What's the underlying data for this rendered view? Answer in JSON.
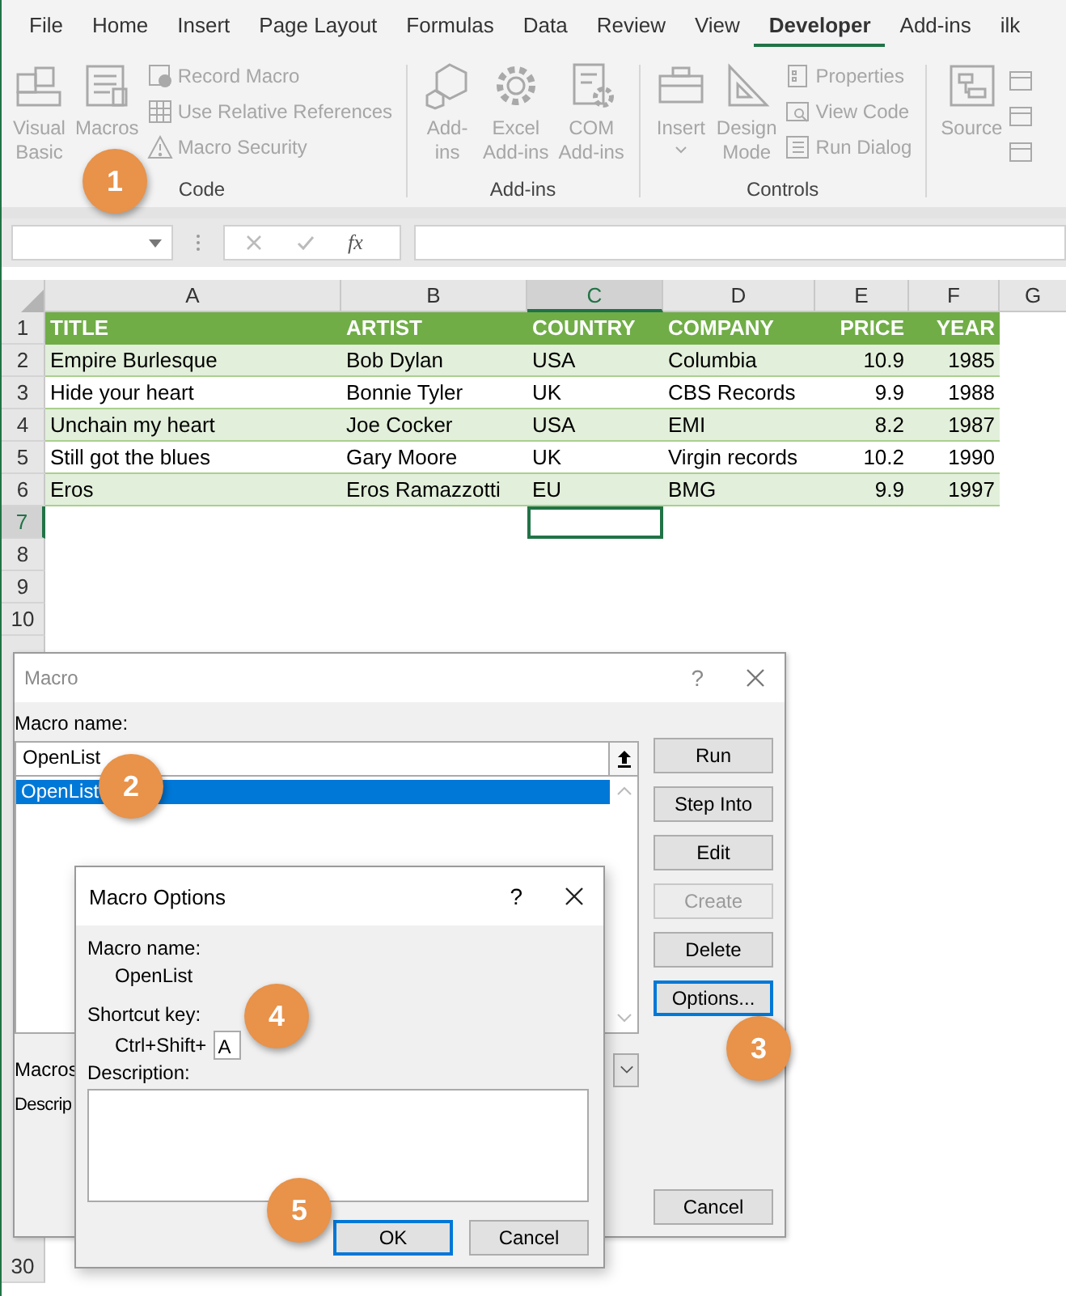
{
  "ribbon": {
    "tabs": [
      {
        "label": "File",
        "selected": false
      },
      {
        "label": "Home",
        "selected": false
      },
      {
        "label": "Insert",
        "selected": false
      },
      {
        "label": "Page Layout",
        "selected": false
      },
      {
        "label": "Formulas",
        "selected": false
      },
      {
        "label": "Data",
        "selected": false
      },
      {
        "label": "Review",
        "selected": false
      },
      {
        "label": "View",
        "selected": false
      },
      {
        "label": "Developer",
        "selected": true
      },
      {
        "label": "Add-ins",
        "selected": false
      },
      {
        "label": "ilk",
        "selected": false
      }
    ],
    "groups": [
      {
        "label": "Code",
        "large": [
          {
            "lines": [
              "Visual",
              "Basic"
            ],
            "dropdown": false
          },
          {
            "lines": [
              "Macros"
            ],
            "dropdown": false
          }
        ],
        "small": [
          "Record Macro",
          "Use Relative References",
          "Macro Security"
        ]
      },
      {
        "label": "Add-ins",
        "large": [
          {
            "lines": [
              "Add-",
              "ins"
            ],
            "dropdown": false
          },
          {
            "lines": [
              "Excel",
              "Add-ins"
            ],
            "dropdown": false
          },
          {
            "lines": [
              "COM",
              "Add-ins"
            ],
            "dropdown": false
          }
        ]
      },
      {
        "label": "Controls",
        "large": [
          {
            "lines": [
              "Insert"
            ],
            "dropdown": true
          },
          {
            "lines": [
              "Design",
              "Mode"
            ],
            "dropdown": false
          }
        ],
        "small": [
          "Properties",
          "View Code",
          "Run Dialog"
        ]
      },
      {
        "large": [
          {
            "lines": [
              "Source"
            ],
            "dropdown": false
          }
        ]
      }
    ]
  },
  "formula_bar": {
    "function_label": "fx"
  },
  "sheet": {
    "columns": [
      {
        "letter": "A",
        "selected": false,
        "kind": "text"
      },
      {
        "letter": "B",
        "selected": false,
        "kind": "text"
      },
      {
        "letter": "C",
        "selected": true,
        "kind": "text"
      },
      {
        "letter": "D",
        "selected": false,
        "kind": "text"
      },
      {
        "letter": "E",
        "selected": false,
        "kind": "number"
      },
      {
        "letter": "F",
        "selected": false,
        "kind": "number"
      },
      {
        "letter": "G",
        "selected": false
      }
    ],
    "rows": [
      {
        "number": "1",
        "selected": false,
        "kind": "header",
        "cells": [
          {
            "text": "TITLE",
            "selected": false
          },
          {
            "text": "ARTIST",
            "selected": false
          },
          {
            "text": "COUNTRY",
            "selected": false
          },
          {
            "text": "COMPANY",
            "selected": false
          },
          {
            "text": "PRICE",
            "selected": false
          },
          {
            "text": "YEAR",
            "selected": false
          }
        ]
      },
      {
        "number": "2",
        "selected": false,
        "kind": "shaded",
        "cells": [
          {
            "text": "Empire Burlesque",
            "selected": false
          },
          {
            "text": "Bob Dylan",
            "selected": false
          },
          {
            "text": "USA",
            "selected": false
          },
          {
            "text": "Columbia",
            "selected": false
          },
          {
            "text": "10.9",
            "selected": false
          },
          {
            "text": "1985",
            "selected": false
          }
        ]
      },
      {
        "number": "3",
        "selected": false,
        "kind": "plain",
        "cells": [
          {
            "text": "Hide your heart",
            "selected": false
          },
          {
            "text": "Bonnie Tyler",
            "selected": false
          },
          {
            "text": "UK",
            "selected": false
          },
          {
            "text": "CBS Records",
            "selected": false
          },
          {
            "text": "9.9",
            "selected": false
          },
          {
            "text": "1988",
            "selected": false
          }
        ]
      },
      {
        "number": "4",
        "selected": false,
        "kind": "shaded",
        "cells": [
          {
            "text": "Unchain my heart",
            "selected": false
          },
          {
            "text": "Joe Cocker",
            "selected": false
          },
          {
            "text": "USA",
            "selected": false
          },
          {
            "text": "EMI",
            "selected": false
          },
          {
            "text": "8.2",
            "selected": false
          },
          {
            "text": "1987",
            "selected": false
          }
        ]
      },
      {
        "number": "5",
        "selected": false,
        "kind": "plain",
        "cells": [
          {
            "text": "Still got the blues",
            "selected": false
          },
          {
            "text": "Gary Moore",
            "selected": false
          },
          {
            "text": "UK",
            "selected": false
          },
          {
            "text": "Virgin records",
            "selected": false
          },
          {
            "text": "10.2",
            "selected": false
          },
          {
            "text": "1990",
            "selected": false
          }
        ]
      },
      {
        "number": "6",
        "selected": false,
        "kind": "shaded",
        "cells": [
          {
            "text": "Eros",
            "selected": false
          },
          {
            "text": "Eros Ramazzotti",
            "selected": false
          },
          {
            "text": "EU",
            "selected": false
          },
          {
            "text": "BMG",
            "selected": false
          },
          {
            "text": "9.9",
            "selected": false
          },
          {
            "text": "1997",
            "selected": false
          }
        ]
      },
      {
        "number": "7",
        "selected": true,
        "kind": "empty"
      },
      {
        "number": "8",
        "selected": false,
        "kind": "empty"
      },
      {
        "number": "9",
        "selected": false,
        "kind": "empty"
      },
      {
        "number": "10",
        "selected": false,
        "kind": "empty"
      }
    ],
    "lower_rows": [
      {
        "number": "30"
      }
    ]
  },
  "macro_dialog": {
    "title": "Macro",
    "help": "?",
    "name_label": "Macro name:",
    "name_value": "OpenList",
    "macros": [
      {
        "name": "OpenList",
        "selected": true
      }
    ],
    "buttons": [
      {
        "label": "Run",
        "disabled": false,
        "focused": false
      },
      {
        "label": "Step Into",
        "disabled": false,
        "focused": false
      },
      {
        "label": "Edit",
        "disabled": false,
        "focused": false
      },
      {
        "label": "Create",
        "disabled": true,
        "focused": false
      },
      {
        "label": "Delete",
        "disabled": false,
        "focused": false
      },
      {
        "label": "Options...",
        "disabled": false,
        "focused": true
      },
      {
        "label": "Cancel",
        "disabled": false,
        "focused": false
      }
    ],
    "macros_in_label": "Macros",
    "description_label": "Descrip"
  },
  "options_dialog": {
    "title": "Macro Options",
    "help": "?",
    "name_label": "Macro name:",
    "name_value": "OpenList",
    "shortcut_label": "Shortcut key:",
    "shortcut_prefix": "Ctrl+Shift+",
    "shortcut_value": "A",
    "description_label": "Description:",
    "buttons": [
      {
        "label": "OK",
        "focused": true
      },
      {
        "label": "Cancel",
        "focused": false
      }
    ]
  },
  "callouts": [
    {
      "label": "1"
    },
    {
      "label": "2"
    },
    {
      "label": "3"
    },
    {
      "label": "4"
    },
    {
      "label": "5"
    }
  ]
}
